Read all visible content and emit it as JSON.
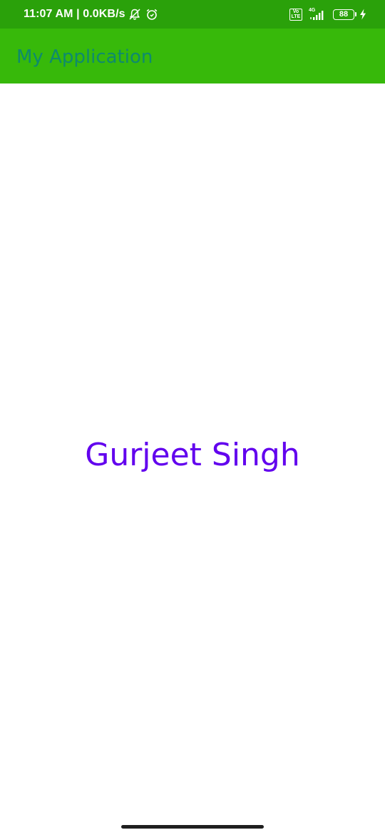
{
  "status_bar": {
    "time_speed": "11:07 AM | 0.0KB/s",
    "volte_top": "Vo",
    "volte_bottom": "LTE",
    "network_type": "4G",
    "battery_level": "88",
    "icons": [
      "bell-off-icon",
      "alarm-icon",
      "volte-icon",
      "signal-icon",
      "battery-icon",
      "charging-bolt-icon"
    ],
    "background_color": "#2aa10a"
  },
  "app_bar": {
    "title": "My Application",
    "background_color": "#37b90a",
    "title_color": "#0e8a6e"
  },
  "main": {
    "name_text": "Gurjeet Singh",
    "text_color": "#6200ee"
  }
}
